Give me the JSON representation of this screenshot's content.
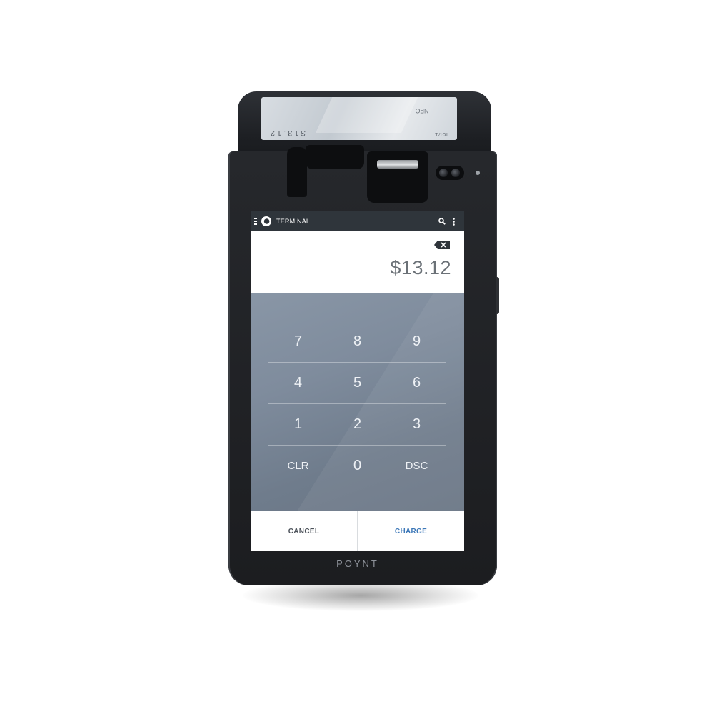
{
  "device": {
    "brand": "POYNT"
  },
  "customer_display": {
    "total_label": "TOTAL",
    "total_value": "$13.12",
    "nfc_label": "NFC"
  },
  "app_bar": {
    "title": "TERMINAL",
    "icons": [
      "menu-icon",
      "poynt-logo-icon",
      "search-icon",
      "more-vert-icon"
    ]
  },
  "amount": {
    "value": "$13.12"
  },
  "keypad": {
    "rows": [
      [
        "7",
        "8",
        "9"
      ],
      [
        "4",
        "5",
        "6"
      ],
      [
        "1",
        "2",
        "3"
      ],
      [
        "CLR",
        "0",
        "DSC"
      ]
    ]
  },
  "actions": {
    "cancel_label": "CANCEL",
    "charge_label": "CHARGE"
  },
  "colors": {
    "app_bar": "#2f353b",
    "keypad": "#7f8c9d",
    "charge_accent": "#3d78b8"
  }
}
